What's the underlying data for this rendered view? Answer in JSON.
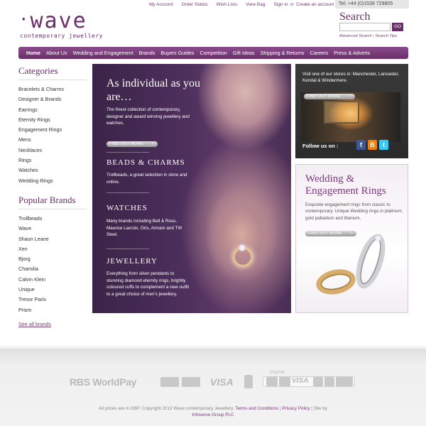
{
  "logo": {
    "word": "wave",
    "tagline": "contemporary jewellery"
  },
  "toplinks": {
    "my_account": "My Account",
    "order_status": "Order Status",
    "wish_lists": "Wish Lists",
    "view_bag": "View Bag",
    "sign_in": "Sign in",
    "or": "or",
    "create_account": "Create an account"
  },
  "contact": {
    "tel": "Tel: +44 (0)1539 729805"
  },
  "search": {
    "title": "Search",
    "input_value": "",
    "go_label": "GO",
    "advanced": "Advanced Search",
    "separator": "|",
    "tips": "Search Tips"
  },
  "nav": {
    "items": [
      {
        "label": "Home"
      },
      {
        "label": "About Us"
      },
      {
        "label": "Wedding and Engagement"
      },
      {
        "label": "Brands"
      },
      {
        "label": "Buyers Guides"
      },
      {
        "label": "Competition"
      },
      {
        "label": "Gift Ideas"
      },
      {
        "label": "Shipping & Returns"
      },
      {
        "label": "Careers"
      },
      {
        "label": "Press & Adverts"
      }
    ],
    "active_index": 0
  },
  "sidebar": {
    "categories_title": "Categories",
    "categories": [
      "Bracelets & Charms",
      "Designer & Brands",
      "Earrings",
      "Eternity Rings",
      "Engagement Rings",
      "Mens",
      "Necklaces",
      "Rings",
      "Watches",
      "Wedding Rings"
    ],
    "brands_title": "Popular Brands",
    "brands": [
      "Trollbeads",
      "Wave",
      "Shaun Leane",
      "Xen",
      "Bjorg",
      "Chamilia",
      "Calvin Klein",
      "Unique",
      "Tresor Paris",
      "Prism"
    ],
    "see_all": "See all brands"
  },
  "hero": {
    "title": "As individual as you are…",
    "intro": "The finest collection of contemporary, designer and award winning jewellery and watches.",
    "find_out_more": "FIND OUT MORE",
    "beads_title": "BEADS & CHARMS",
    "beads_text": "Trollbeads, a great selection in store and online.",
    "watches_title": "WATCHES",
    "watches_text": "Many brands including Bell & Ross, Maurice Lacroix, Oris, Armani and TW Steel.",
    "jewellery_title": "JEWELLERY",
    "jewellery_text": "Everything from silver pendants to stunning diamond eternity rings, brightly coloured cuffs to complement a new outfit to a great choice of men's jewellery."
  },
  "stores": {
    "text": "Visit one of our stores in: Manchester, Lancaster, Kendal & Windermere.",
    "find_out_more": "FIND OUT MORE",
    "follow": "Follow us on :",
    "social": {
      "facebook": "f",
      "blogger": "B",
      "twitter": "t"
    },
    "colors": {
      "facebook": "#3b5998",
      "blogger": "#f57d00",
      "twitter": "#33ccff"
    }
  },
  "wedding": {
    "title": "Wedding & Engagement Rings",
    "text": "Exquisite engagement rings from classic to contemporary. Unique Wedding rings in platinum, gold palladium and titanium.",
    "find_out_more": "FIND OUT MORE"
  },
  "footer": {
    "rbs": "RBS WorldPay",
    "visa": "VISA",
    "paypal": "PayPal",
    "strip_visa": "VISA",
    "copyright": "All prices are in GBP. Copyright 2013 Wave contemporary Jewellery.",
    "terms": "Terms and Conditions",
    "sep": "|",
    "privacy": "Privacy Policy",
    "site_by": "Site by",
    "agency": "Infoserve Group PLC"
  },
  "colors": {
    "brand": "#6b2e6b",
    "nav": "#7a3b7a"
  }
}
